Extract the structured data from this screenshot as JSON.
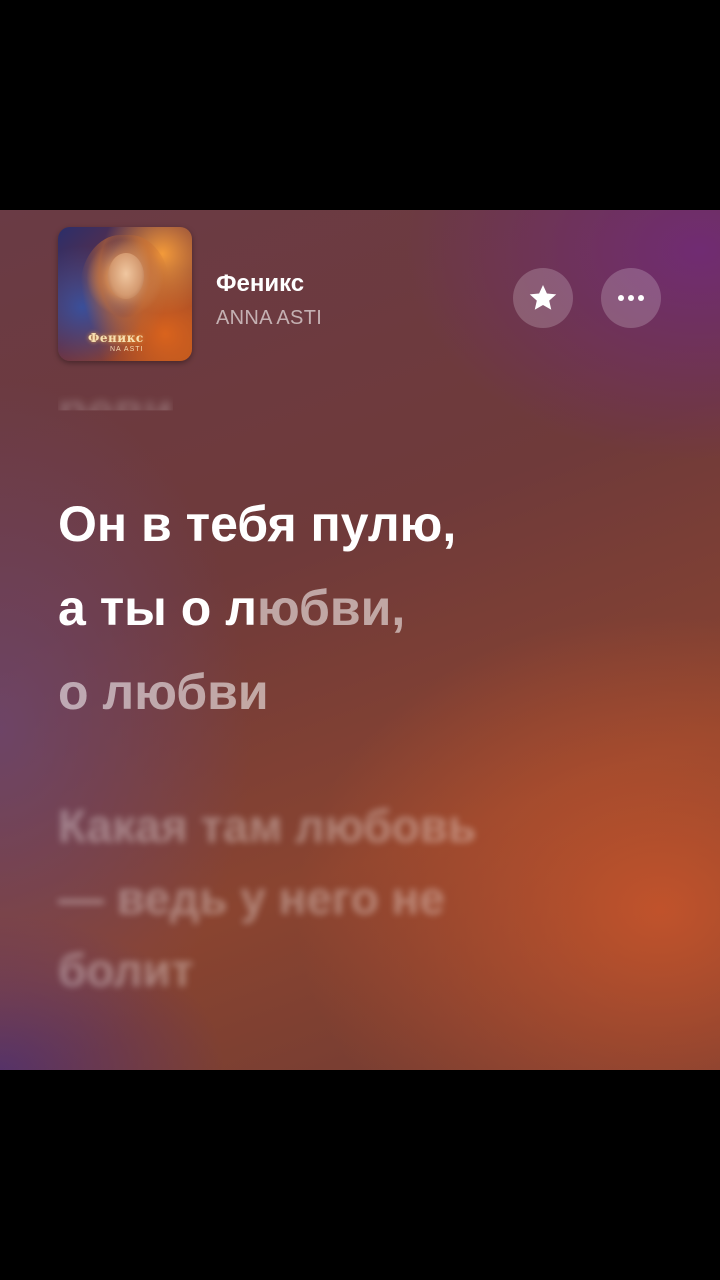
{
  "track": {
    "title": "Феникс",
    "artist": "ANNA ASTI",
    "cover": {
      "title_text": "Феникс",
      "artist_text": "NA ASTI"
    }
  },
  "actions": {
    "favorite_icon": "star-icon",
    "more_icon": "ellipsis-icon"
  },
  "lyrics": {
    "previous_line": "реви",
    "current": {
      "line1": "Он в тебя пулю,",
      "line2_sung": "а ты о л",
      "line2_unsung": "юбви,",
      "line3": "о любви"
    },
    "next": {
      "line1": "Какая там любовь",
      "line2": "— ведь у него не",
      "line3": "болит"
    }
  },
  "colors": {
    "background_top": "#6a3b45",
    "background_accent": "#cc562a",
    "text_primary": "#ffffff"
  }
}
